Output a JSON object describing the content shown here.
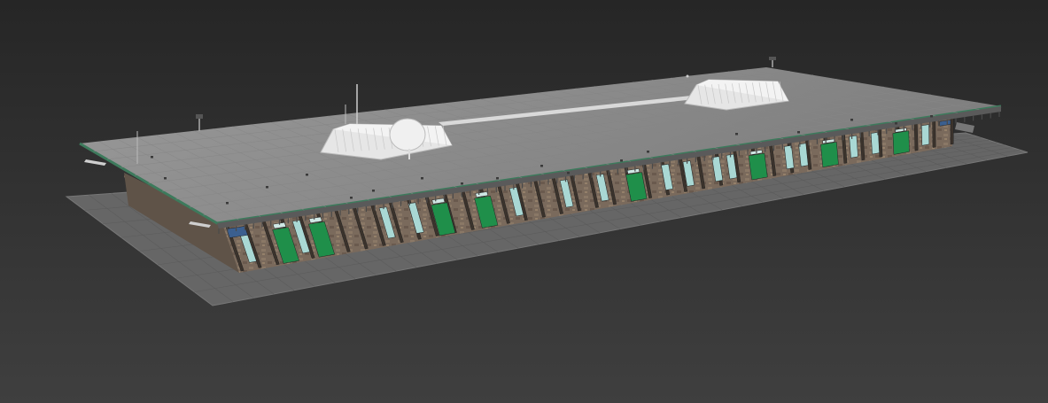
{
  "scene": {
    "subject": "single-storey-building-model",
    "colors": {
      "background_top": "#262626",
      "background_bottom": "#3f3f3f",
      "roof": "#8e8e8e",
      "roof_edge": "#3d7a5c",
      "ground": "#6a6a6a",
      "wall": "#7a6a5c",
      "door": "#1f8f4a",
      "window": "#a9d8d4",
      "skylight": "#e8e8e8",
      "fascia": "#5a5a5a"
    },
    "doors_front": 8,
    "windows_front": 16
  }
}
